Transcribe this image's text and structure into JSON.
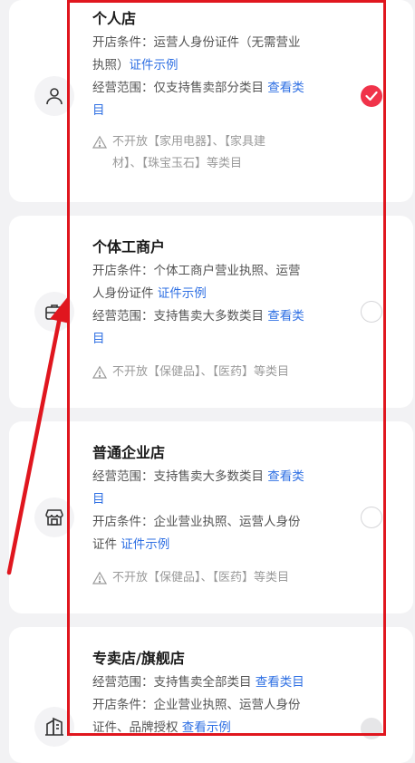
{
  "options": [
    {
      "title": "个人店",
      "line1_prefix": "开店条件：",
      "line1_text_a": "运营人身份证件（无需营业",
      "line1_text_b": "执照）",
      "line1_link": "证件示例",
      "line2_prefix": "经营范围：",
      "line2_text": "仅支持售卖部分类目",
      "line2_link_a": "查看类",
      "line2_link_b": "目",
      "warn_a": "不开放【家用电器】、【家具建",
      "warn_b": "材】、【珠宝玉石】等类目",
      "icon": "person-icon",
      "selected": true
    },
    {
      "title": "个体工商户",
      "line1_prefix": "开店条件：",
      "line1_text_a": "个体工商户营业执照、运营",
      "line1_text_b": "人身份证件",
      "line1_link": "证件示例",
      "line2_prefix": "经营范围：",
      "line2_text": "支持售卖大多数类目",
      "line2_link_a": "查看类",
      "line2_link_b": "目",
      "warn": "不开放【保健品】、【医药】等类目",
      "icon": "briefcase-icon",
      "selected": false
    },
    {
      "title": "普通企业店",
      "line1_prefix": "经营范围：",
      "line1_text": "支持售卖大多数类目",
      "line1_link_a": "查看类",
      "line1_link_b": "目",
      "line2_prefix": "开店条件：",
      "line2_text_a": "企业营业执照、运营人身份",
      "line2_text_b": "证件",
      "line2_link": "证件示例",
      "warn": "不开放【保健品】、【医药】等类目",
      "icon": "storefront-icon",
      "selected": false
    },
    {
      "title": "专卖店/旗舰店",
      "line1_prefix": "经营范围：",
      "line1_text": "支持售卖全部类目",
      "line1_link": "查看类目",
      "line2_prefix": "开店条件：",
      "line2_text_a": "企业营业执照、运营人身份",
      "line2_text_b": "证件、品牌授权",
      "line2_link": "查看示例",
      "icon": "building-icon",
      "selected": false
    }
  ],
  "colors": {
    "accent": "#f0334a",
    "link": "#2e6fe3",
    "annotation": "#e0161e"
  }
}
